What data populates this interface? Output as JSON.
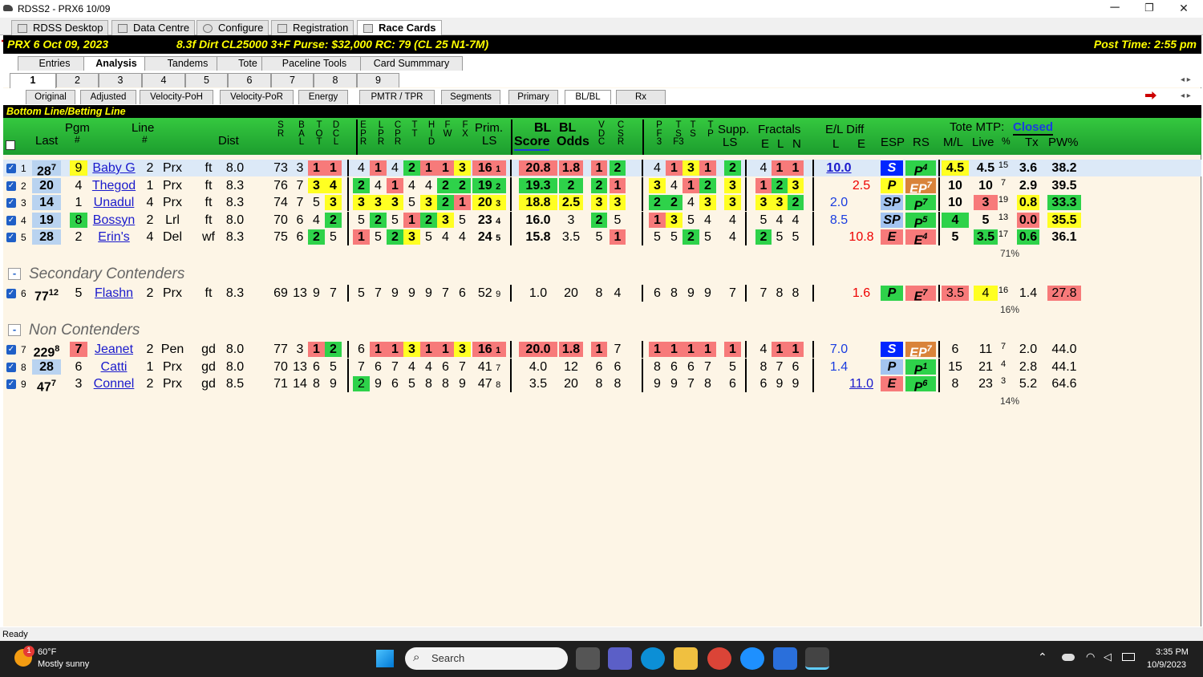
{
  "window": {
    "title": "RDSS2 - PRX6  10/09",
    "min": "─",
    "max": "❐",
    "close": "✕"
  },
  "app_tabs": [
    {
      "label": "RDSS Desktop"
    },
    {
      "label": "Data Centre"
    },
    {
      "label": "Configure"
    },
    {
      "label": "Registration"
    },
    {
      "label": "Race Cards"
    }
  ],
  "race": {
    "info": "PRX 6  Oct 09, 2023",
    "details": "8.3f  Dirt  CL25000  3+F  Purse: $32,000  RC: 79  (CL 25 N1-7M)",
    "post_time": "Post Time: 2:55 pm"
  },
  "main_tabs": [
    "Entries",
    "Analysis",
    "Tandems",
    "Tote",
    "Paceline Tools",
    "Card Summmary"
  ],
  "race_numbers": [
    "1",
    "2",
    "3",
    "4",
    "5",
    "6",
    "7",
    "8",
    "9"
  ],
  "sub_tabs": [
    "Original",
    "Adjusted",
    "Velocity-PoH",
    "Velocity-PoR",
    "Energy",
    "PMTR / TPR",
    "Segments",
    "Primary",
    "BL/BL",
    "Rx"
  ],
  "nav_arrows": "◂ ▸",
  "section_title": "Bottom Line/Betting Line",
  "headers": {
    "last": "Last",
    "pgm": "Pgm",
    "pgm_hash": "#",
    "line": "Line",
    "line_hash": "#",
    "dist": "Dist",
    "prim": "Prim.",
    "ls": "LS",
    "bl": "BL",
    "bl2": "BL",
    "score": "Score",
    "odds": "Odds",
    "supp": "Supp.",
    "supp_ls": "LS",
    "fractals": "Fractals",
    "f_e": "E",
    "f_l": "L",
    "f_n": "N",
    "el_diff": "E/L Diff",
    "el_l": "L",
    "el_e": "E",
    "esp": "ESP",
    "rs": "RS",
    "tote_mtp": "Tote MTP:",
    "tote_status": "Closed",
    "ml": "M/L",
    "live": "Live",
    "pct": "%",
    "tx": "Tx",
    "pw": "PW%",
    "v_sr": [
      "S",
      "R"
    ],
    "v_bal": [
      "B",
      "A",
      "L"
    ],
    "v_tot": [
      "T",
      "O",
      "T"
    ],
    "v_dcl": [
      "D",
      "C",
      "L"
    ],
    "v_epr": [
      "E",
      "P",
      "R"
    ],
    "v_lpr": [
      "L",
      "P",
      "R"
    ],
    "v_cpr": [
      "C",
      "P",
      "R"
    ],
    "v_tt": [
      "T",
      "T"
    ],
    "v_hid": [
      "H",
      "I",
      "D"
    ],
    "v_fw": [
      "F",
      "W"
    ],
    "v_fx": [
      "F",
      "X"
    ],
    "v_vdc": [
      "V",
      "D",
      "C"
    ],
    "v_csr": [
      "C",
      "S",
      "R"
    ],
    "v_pf3": [
      "P",
      "F",
      "3"
    ],
    "v_tsf3": [
      "T",
      "S",
      "F3"
    ],
    "v_ts": [
      "T",
      "S"
    ],
    "v_tp": [
      "T",
      "P"
    ]
  },
  "contenders": [
    {
      "n": "1",
      "last": "28",
      "last_sup": "7",
      "pgm": "9",
      "name": "Baby G",
      "line": "2",
      "trk": "Prx",
      "cond": "ft",
      "dist": "8.0",
      "sr": "73",
      "bal": "3",
      "tot": "1",
      "dcl": "1",
      "epr": "4",
      "lpr": "1",
      "cpr": "4",
      "tt": "2",
      "hid": "1",
      "fw": "1",
      "fx": "3",
      "prim": "16",
      "prim_sup": "1",
      "score": "20.8",
      "odds": "1.8",
      "vdc": "1",
      "csr": "2",
      "pf3": "4",
      "tsf3": "1",
      "ts": "3",
      "tp": "1",
      "supp": "2",
      "fe": "4",
      "fl": "1",
      "fn": "1",
      "el_l": "10.0",
      "el_e": "",
      "esp": "S",
      "rs": "P",
      "rs_sup": "4",
      "ml": "4.5",
      "live": "4.5",
      "pct": "15",
      "tx": "3.6",
      "pw": "38.2"
    },
    {
      "n": "2",
      "last": "20",
      "last_sup": "",
      "pgm": "4",
      "name": "Thegod",
      "line": "1",
      "trk": "Prx",
      "cond": "ft",
      "dist": "8.3",
      "sr": "76",
      "bal": "7",
      "tot": "3",
      "dcl": "4",
      "epr": "2",
      "lpr": "4",
      "cpr": "1",
      "tt": "4",
      "hid": "4",
      "fw": "2",
      "fx": "2",
      "prim": "19",
      "prim_sup": "2",
      "score": "19.3",
      "odds": "2",
      "vdc": "2",
      "csr": "1",
      "pf3": "3",
      "tsf3": "4",
      "ts": "1",
      "tp": "2",
      "supp": "3",
      "fe": "1",
      "fl": "2",
      "fn": "3",
      "el_l": "",
      "el_e": "2.5",
      "esp": "P",
      "rs": "EP",
      "rs_sup": "7",
      "ml": "10",
      "live": "10",
      "pct": "7",
      "tx": "2.9",
      "pw": "39.5"
    },
    {
      "n": "3",
      "last": "14",
      "last_sup": "",
      "pgm": "1",
      "name": "Unadul",
      "line": "4",
      "trk": "Prx",
      "cond": "ft",
      "dist": "8.3",
      "sr": "74",
      "bal": "7",
      "tot": "5",
      "dcl": "3",
      "epr": "3",
      "lpr": "3",
      "cpr": "3",
      "tt": "5",
      "hid": "3",
      "fw": "2",
      "fx": "1",
      "prim": "20",
      "prim_sup": "3",
      "score": "18.8",
      "odds": "2.5",
      "vdc": "3",
      "csr": "3",
      "pf3": "2",
      "tsf3": "2",
      "ts": "4",
      "tp": "3",
      "supp": "3",
      "fe": "3",
      "fl": "3",
      "fn": "2",
      "el_l": "2.0",
      "el_e": "",
      "esp": "SP",
      "rs": "P",
      "rs_sup": "7",
      "ml": "10",
      "live": "3",
      "pct": "19",
      "tx": "0.8",
      "pw": "33.3"
    },
    {
      "n": "4",
      "last": "19",
      "last_sup": "",
      "pgm": "8",
      "name": "Bossyn",
      "line": "2",
      "trk": "Lrl",
      "cond": "ft",
      "dist": "8.0",
      "sr": "70",
      "bal": "6",
      "tot": "4",
      "dcl": "2",
      "epr": "5",
      "lpr": "2",
      "cpr": "5",
      "tt": "1",
      "hid": "2",
      "fw": "3",
      "fx": "5",
      "prim": "23",
      "prim_sup": "4",
      "score": "16.0",
      "odds": "3",
      "vdc": "2",
      "csr": "5",
      "pf3": "1",
      "tsf3": "3",
      "ts": "5",
      "tp": "4",
      "supp": "4",
      "fe": "5",
      "fl": "4",
      "fn": "4",
      "el_l": "8.5",
      "el_e": "",
      "esp": "SP",
      "rs": "P",
      "rs_sup": "5",
      "ml": "4",
      "live": "5",
      "pct": "13",
      "tx": "0.0",
      "pw": "35.5"
    },
    {
      "n": "5",
      "last": "28",
      "last_sup": "",
      "pgm": "2",
      "name": "Erin's",
      "line": "4",
      "trk": "Del",
      "cond": "wf",
      "dist": "8.3",
      "sr": "75",
      "bal": "6",
      "tot": "2",
      "dcl": "5",
      "epr": "1",
      "lpr": "5",
      "cpr": "2",
      "tt": "3",
      "hid": "5",
      "fw": "4",
      "fx": "4",
      "prim": "24",
      "prim_sup": "5",
      "score": "15.8",
      "odds": "3.5",
      "vdc": "5",
      "csr": "1",
      "pf3": "5",
      "tsf3": "5",
      "ts": "2",
      "tp": "5",
      "supp": "4",
      "fe": "2",
      "fl": "5",
      "fn": "5",
      "el_l": "",
      "el_e": "10.8",
      "esp": "E",
      "rs": "E",
      "rs_sup": "4",
      "ml": "5",
      "live": "3.5",
      "pct": "17",
      "tx": "0.6",
      "pw": "36.1"
    }
  ],
  "group1_pct": "71%",
  "secondary_label": "Secondary Contenders",
  "secondary": [
    {
      "n": "6",
      "last": "77",
      "last_sup": "12",
      "pgm": "5",
      "name": "Flashn",
      "line": "2",
      "trk": "Prx",
      "cond": "ft",
      "dist": "8.3",
      "sr": "69",
      "bal": "13",
      "tot": "9",
      "dcl": "7",
      "epr": "5",
      "lpr": "7",
      "cpr": "9",
      "tt": "9",
      "hid": "9",
      "fw": "7",
      "fx": "6",
      "prim": "52",
      "prim_sup": "9",
      "score": "1.0",
      "odds": "20",
      "vdc": "8",
      "csr": "4",
      "pf3": "6",
      "tsf3": "8",
      "ts": "9",
      "tp": "9",
      "supp": "7",
      "fe": "7",
      "fl": "8",
      "fn": "8",
      "el_l": "",
      "el_e": "1.6",
      "esp": "P",
      "rs": "E",
      "rs_sup": "7",
      "ml": "3.5",
      "live": "4",
      "pct": "16",
      "tx": "1.4",
      "pw": "27.8"
    }
  ],
  "group2_pct": "16%",
  "non_label": "Non Contenders",
  "non": [
    {
      "n": "7",
      "last": "229",
      "last_sup": "8",
      "pgm": "7",
      "name": "Jeanet",
      "line": "2",
      "trk": "Pen",
      "cond": "gd",
      "dist": "8.0",
      "sr": "77",
      "bal": "3",
      "tot": "1",
      "dcl": "2",
      "epr": "6",
      "lpr": "1",
      "cpr": "1",
      "tt": "3",
      "hid": "1",
      "fw": "1",
      "fx": "3",
      "prim": "16",
      "prim_sup": "1",
      "score": "20.0",
      "odds": "1.8",
      "vdc": "1",
      "csr": "7",
      "pf3": "1",
      "tsf3": "1",
      "ts": "1",
      "tp": "1",
      "supp": "1",
      "fe": "4",
      "fl": "1",
      "fn": "1",
      "el_l": "7.0",
      "el_e": "",
      "esp": "S",
      "rs": "EP",
      "rs_sup": "7",
      "ml": "6",
      "live": "11",
      "pct": "7",
      "tx": "2.0",
      "pw": "44.0"
    },
    {
      "n": "8",
      "last": "28",
      "last_sup": "",
      "pgm": "6",
      "name": "Catti ",
      "line": "1",
      "trk": "Prx",
      "cond": "gd",
      "dist": "8.0",
      "sr": "70",
      "bal": "13",
      "tot": "6",
      "dcl": "5",
      "epr": "7",
      "lpr": "6",
      "cpr": "7",
      "tt": "4",
      "hid": "4",
      "fw": "6",
      "fx": "7",
      "prim": "41",
      "prim_sup": "7",
      "score": "4.0",
      "odds": "12",
      "vdc": "6",
      "csr": "6",
      "pf3": "8",
      "tsf3": "6",
      "ts": "6",
      "tp": "7",
      "supp": "5",
      "fe": "8",
      "fl": "7",
      "fn": "6",
      "el_l": "1.4",
      "el_e": "",
      "esp": "P",
      "rs": "P",
      "rs_sup": "1",
      "ml": "15",
      "live": "21",
      "pct": "4",
      "tx": "2.8",
      "pw": "44.1"
    },
    {
      "n": "9",
      "last": "47",
      "last_sup": "7",
      "pgm": "3",
      "name": "Connel",
      "line": "2",
      "trk": "Prx",
      "cond": "gd",
      "dist": "8.5",
      "sr": "71",
      "bal": "14",
      "tot": "8",
      "dcl": "9",
      "epr": "2",
      "lpr": "9",
      "cpr": "6",
      "tt": "5",
      "hid": "8",
      "fw": "8",
      "fx": "9",
      "prim": "47",
      "prim_sup": "8",
      "score": "3.5",
      "odds": "20",
      "vdc": "8",
      "csr": "8",
      "pf3": "9",
      "tsf3": "9",
      "ts": "7",
      "tp": "8",
      "supp": "6",
      "fe": "6",
      "fl": "9",
      "fn": "9",
      "el_l": "",
      "el_e": "11.0",
      "esp": "E",
      "rs": "P",
      "rs_sup": "6",
      "ml": "8",
      "live": "23",
      "pct": "3",
      "tx": "5.2",
      "pw": "64.6"
    }
  ],
  "group3_pct": "14%",
  "status": "Ready",
  "taskbar": {
    "weather_temp": "60°F",
    "weather_desc": "Mostly sunny",
    "weather_badge": "1",
    "search": "Search",
    "time": "3:35 PM",
    "date": "10/9/2023"
  }
}
